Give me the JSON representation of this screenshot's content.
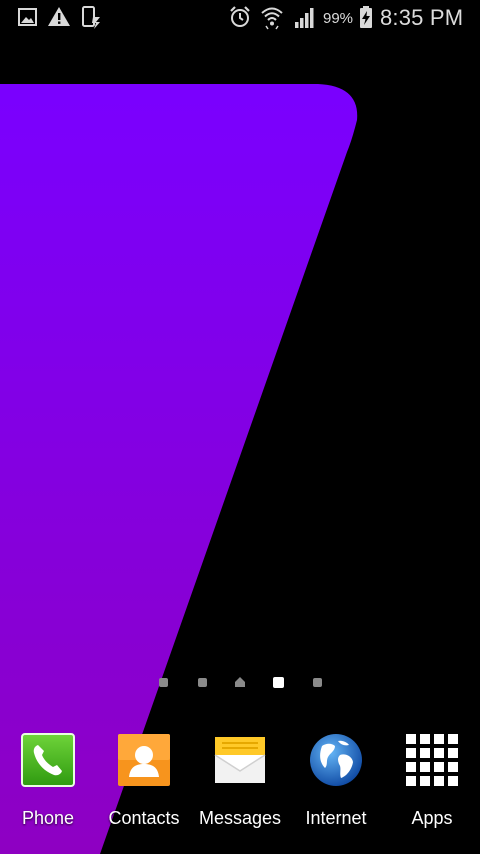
{
  "status_bar": {
    "left_icons": [
      "gallery-icon",
      "warning-icon",
      "device-sync-icon"
    ],
    "right_icons": [
      "alarm-icon",
      "wifi-icon",
      "cell-signal-icon",
      "battery-charging-icon"
    ],
    "battery_percent": "99%",
    "time": "8:35 PM"
  },
  "wallpaper": {
    "colors": {
      "background": "#000000",
      "accent_top": "#7a00ff",
      "accent_bottom": "#8e00c2"
    }
  },
  "page_indicator": {
    "page_count": 5,
    "home_page_index": 2,
    "active_page_index": 3
  },
  "dock": {
    "apps": [
      {
        "label": "Phone",
        "icon": "phone-icon",
        "color": "#4cbb17"
      },
      {
        "label": "Contacts",
        "icon": "contacts-icon",
        "color": "#f7941d"
      },
      {
        "label": "Messages",
        "icon": "messages-icon",
        "color": "#ffc928"
      },
      {
        "label": "Internet",
        "icon": "globe-icon",
        "color": "#1e88e5"
      },
      {
        "label": "Apps",
        "icon": "apps-grid-icon",
        "color": "#ffffff"
      }
    ]
  }
}
